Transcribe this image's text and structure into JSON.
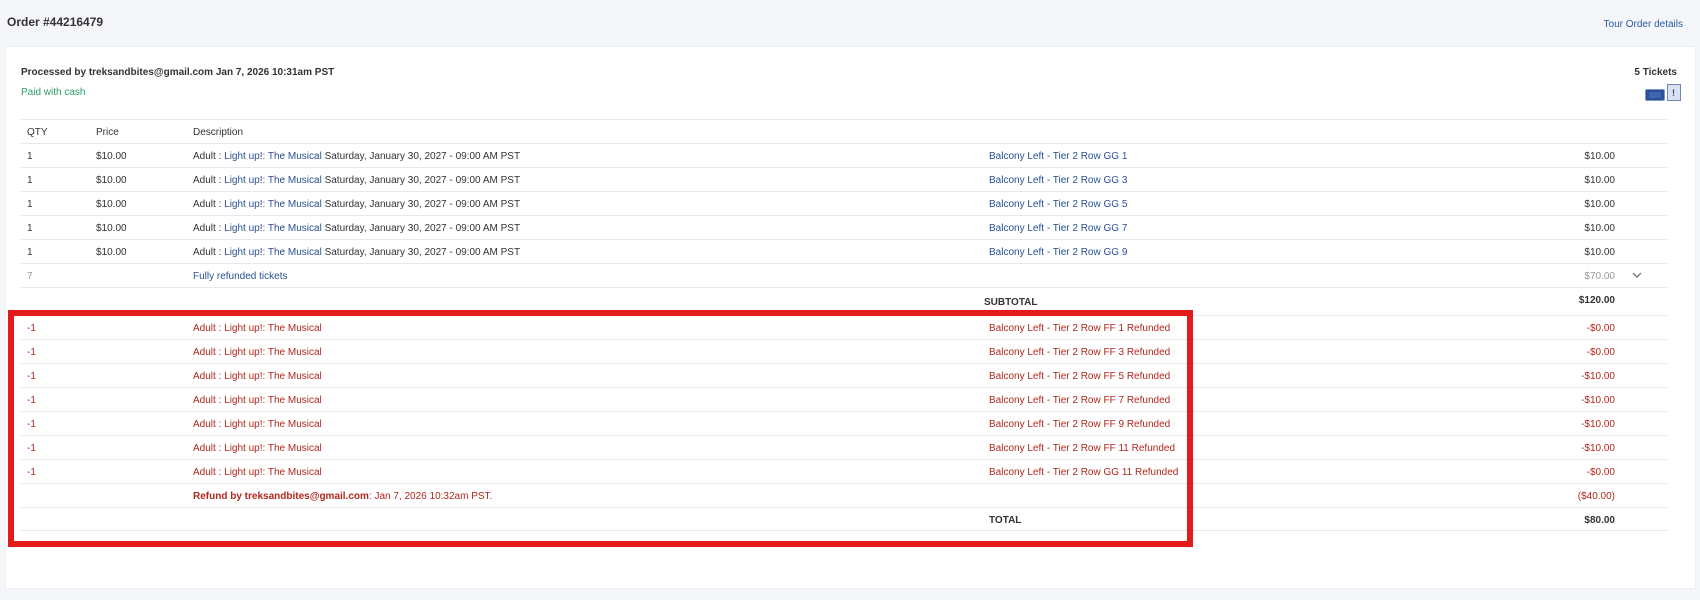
{
  "order": {
    "title": "Order #44216479",
    "tour_link": "Tour Order details",
    "processed": "Processed by treksandbites@gmail.com Jan 7, 2026 10:31am PST",
    "paid": "Paid with cash",
    "tickets": "5 Tickets"
  },
  "table": {
    "headers": {
      "qty": "QTY",
      "price": "Price",
      "description": "Description"
    },
    "rows": [
      {
        "qty": "1",
        "price": "$10.00",
        "type": "Adult : ",
        "event": "Light up!: The Musical",
        "date": " Saturday, January 30, 2027 - 09:00 AM PST",
        "seat": "Balcony Left - Tier 2 Row GG 1",
        "amount": "$10.00"
      },
      {
        "qty": "1",
        "price": "$10.00",
        "type": "Adult : ",
        "event": "Light up!: The Musical",
        "date": " Saturday, January 30, 2027 - 09:00 AM PST",
        "seat": "Balcony Left - Tier 2 Row GG 3",
        "amount": "$10.00"
      },
      {
        "qty": "1",
        "price": "$10.00",
        "type": "Adult : ",
        "event": "Light up!: The Musical",
        "date": " Saturday, January 30, 2027 - 09:00 AM PST",
        "seat": "Balcony Left - Tier 2 Row GG 5",
        "amount": "$10.00"
      },
      {
        "qty": "1",
        "price": "$10.00",
        "type": "Adult : ",
        "event": "Light up!: The Musical",
        "date": " Saturday, January 30, 2027 - 09:00 AM PST",
        "seat": "Balcony Left - Tier 2 Row GG 7",
        "amount": "$10.00"
      },
      {
        "qty": "1",
        "price": "$10.00",
        "type": "Adult : ",
        "event": "Light up!: The Musical",
        "date": " Saturday, January 30, 2027 - 09:00 AM PST",
        "seat": "Balcony Left - Tier 2 Row GG 9",
        "amount": "$10.00"
      }
    ],
    "refunded_summary": {
      "qty": "7",
      "label": "Fully refunded tickets",
      "amount": "$70.00",
      "toggle_icon": "chevron-down-icon"
    },
    "subtotal": {
      "label": "SUBTOTAL",
      "amount": "$120.00"
    },
    "refunds": [
      {
        "qty": "-1",
        "description": "Adult : Light up!: The Musical",
        "seat": "Balcony Left - Tier 2 Row FF 1 Refunded",
        "amount": "-$0.00"
      },
      {
        "qty": "-1",
        "description": "Adult : Light up!: The Musical",
        "seat": "Balcony Left - Tier 2 Row FF 3 Refunded",
        "amount": "-$0.00"
      },
      {
        "qty": "-1",
        "description": "Adult : Light up!: The Musical",
        "seat": "Balcony Left - Tier 2 Row FF 5 Refunded",
        "amount": "-$10.00"
      },
      {
        "qty": "-1",
        "description": "Adult : Light up!: The Musical",
        "seat": "Balcony Left - Tier 2 Row FF 7 Refunded",
        "amount": "-$10.00"
      },
      {
        "qty": "-1",
        "description": "Adult : Light up!: The Musical",
        "seat": "Balcony Left - Tier 2 Row FF 9 Refunded",
        "amount": "-$10.00"
      },
      {
        "qty": "-1",
        "description": "Adult : Light up!: The Musical",
        "seat": "Balcony Left - Tier 2 Row FF 11 Refunded",
        "amount": "-$10.00"
      },
      {
        "qty": "-1",
        "description": "Adult : Light up!: The Musical",
        "seat": "Balcony Left - Tier 2 Row GG 11 Refunded",
        "amount": "-$0.00"
      }
    ],
    "refund_note": {
      "by": "Refund by treksandbites@gmail.com",
      "when": ": Jan 7, 2026 10:32am PST.",
      "amount": "($40.00)"
    },
    "total": {
      "label": "TOTAL",
      "amount": "$80.00"
    }
  },
  "colors": {
    "highlight": "#e31b1b",
    "link": "#2a4f96",
    "refund": "#b2271e",
    "paid": "#2e9d6a"
  },
  "icons": {
    "ticket": "ticket-icon",
    "document": "document-icon"
  }
}
